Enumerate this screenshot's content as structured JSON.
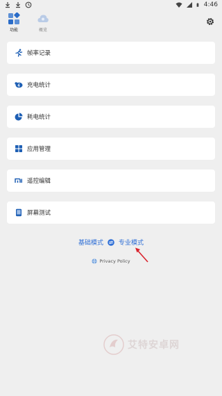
{
  "status_bar": {
    "time": "4:46",
    "left_icons": [
      "download-icon",
      "download-icon",
      "clock-icon"
    ],
    "right_icons": [
      "wifi-icon",
      "cellular-signal-icon",
      "battery-icon"
    ]
  },
  "nav": {
    "tabs": [
      {
        "label": "功能",
        "icon": "grid-icon",
        "active": true
      },
      {
        "label": "概览",
        "icon": "cloud-icon",
        "active": false
      }
    ],
    "settings_icon": "gear-icon"
  },
  "cards": [
    {
      "label": "帧率记录",
      "icon": "running-icon"
    },
    {
      "label": "充电统计",
      "icon": "battery-charge-icon"
    },
    {
      "label": "耗电统计",
      "icon": "pie-chart-icon"
    },
    {
      "label": "应用管理",
      "icon": "apps-grid-icon"
    },
    {
      "label": "遥控编辑",
      "icon": "mi-icon"
    },
    {
      "label": "屏幕测试",
      "icon": "screen-icon"
    }
  ],
  "mode_switch": {
    "basic_label": "基础模式",
    "pro_label": "专业模式",
    "accent": "#2f6fd6"
  },
  "privacy": {
    "label": "Privacy Policy"
  },
  "watermark": {
    "name": "艾特安卓网"
  },
  "colors": {
    "background": "#efefef",
    "card": "#ffffff",
    "icon_blue": "#1e5fb4",
    "arrow_red": "#d9232d"
  }
}
